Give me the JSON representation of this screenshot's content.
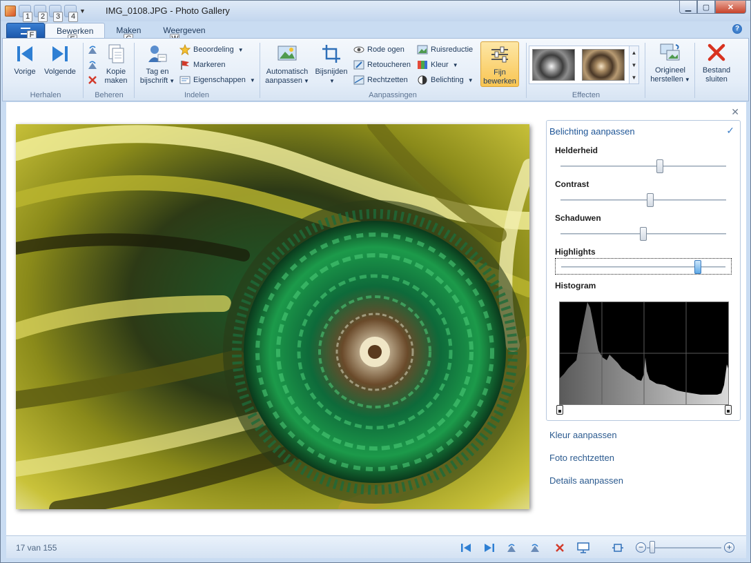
{
  "window": {
    "title": "IMG_0108.JPG - Photo Gallery",
    "qat_keytips": [
      "1",
      "2",
      "3",
      "4"
    ],
    "minimize_icon": "minimize-icon",
    "maximize_icon": "maximize-icon",
    "close_icon": "close-icon"
  },
  "tabs": {
    "app_keytip": "F",
    "items": [
      {
        "label": "Bewerken",
        "keytip": "E",
        "active": true
      },
      {
        "label": "Maken",
        "keytip": "C",
        "active": false
      },
      {
        "label": "Weergeven",
        "keytip": "W",
        "active": false
      }
    ]
  },
  "ribbon": {
    "groups": {
      "herhalen": "Herhalen",
      "beheren": "Beheren",
      "indelen": "Indelen",
      "aanpassingen": "Aanpassingen",
      "effecten": "Effecten"
    },
    "vorige": "Vorige",
    "volgende": "Volgende",
    "kopie_line1": "Kopie",
    "kopie_line2": "maken",
    "tag_line1": "Tag en",
    "tag_line2": "bijschrift",
    "beoordeling": "Beoordeling",
    "markeren": "Markeren",
    "eigenschappen": "Eigenschappen",
    "auto_line1": "Automatisch",
    "auto_line2": "aanpassen",
    "bijsnijden": "Bijsnijden",
    "rode_ogen": "Rode ogen",
    "retoucheren": "Retoucheren",
    "rechtzetten": "Rechtzetten",
    "ruisreductie": "Ruisreductie",
    "kleur": "Kleur",
    "belichting": "Belichting",
    "fijn_line1": "Fijn",
    "fijn_line2": "bewerken",
    "origineel_line1": "Origineel",
    "origineel_line2": "herstellen",
    "sluiten_line1": "Bestand",
    "sluiten_line2": "sluiten"
  },
  "panel": {
    "title": "Belichting aanpassen",
    "sliders": [
      {
        "label": "Helderheid",
        "value": 0.6
      },
      {
        "label": "Contrast",
        "value": 0.54
      },
      {
        "label": "Schaduwen",
        "value": 0.5
      },
      {
        "label": "Highlights",
        "value": 0.83
      }
    ],
    "histogram_label": "Histogram"
  },
  "links": {
    "kleur": "Kleur aanpassen",
    "foto": "Foto rechtzetten",
    "details": "Details aanpassen"
  },
  "status": {
    "position": "17 van 155"
  }
}
